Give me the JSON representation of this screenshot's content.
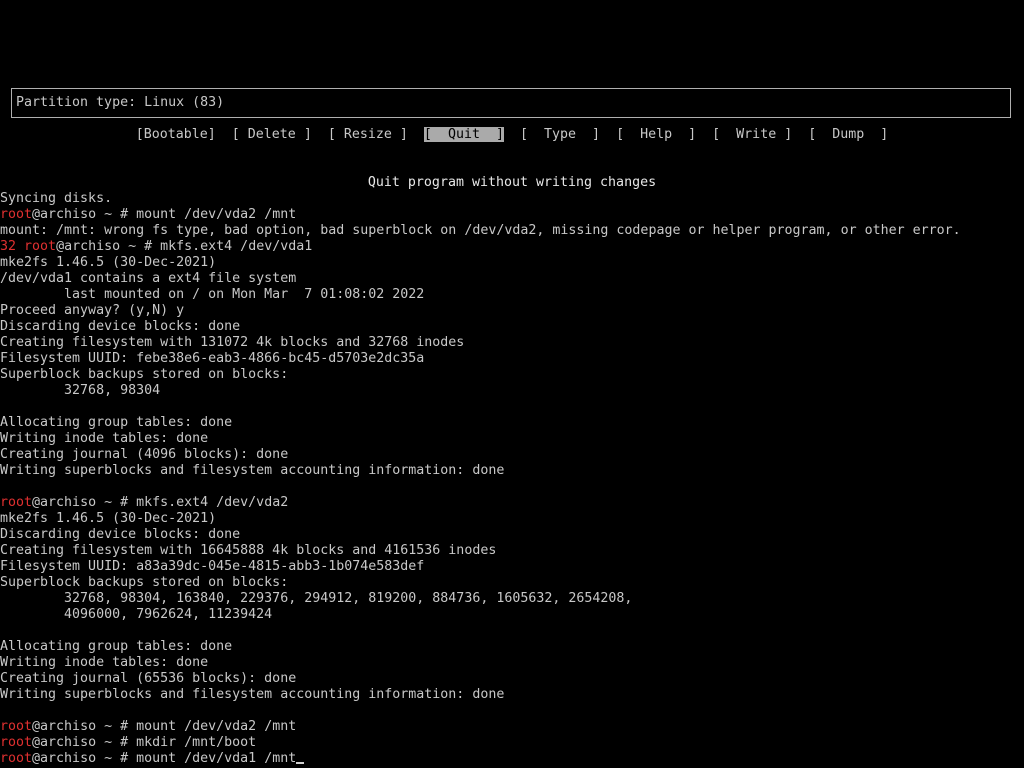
{
  "partition": {
    "type_text": "Partition type: Linux (83)"
  },
  "menu": [
    {
      "label": "[Bootable]",
      "selected": false
    },
    {
      "label": "[ Delete ]",
      "selected": false
    },
    {
      "label": "[ Resize ]",
      "selected": false
    },
    {
      "label": "[  Quit  ]",
      "selected": true
    },
    {
      "label": "[  Type  ]",
      "selected": false
    },
    {
      "label": "[  Help  ]",
      "selected": false
    },
    {
      "label": "[  Write ]",
      "selected": false
    },
    {
      "label": "[  Dump  ]",
      "selected": false
    }
  ],
  "hint": "Quit program without writing changes",
  "terminal": {
    "lines": [
      {
        "text": "Syncing disks."
      },
      {
        "prompt": "root",
        "rest": "@archiso ~ # mount /dev/vda2 /mnt"
      },
      {
        "text": "mount: /mnt: wrong fs type, bad option, bad superblock on /dev/vda2, missing codepage or helper program, or other error."
      },
      {
        "prefix": "32 ",
        "prompt": "root",
        "rest": "@archiso ~ # mkfs.ext4 /dev/vda1"
      },
      {
        "text": "mke2fs 1.46.5 (30-Dec-2021)"
      },
      {
        "text": "/dev/vda1 contains a ext4 file system"
      },
      {
        "text": "        last mounted on / on Mon Mar  7 01:08:02 2022"
      },
      {
        "text": "Proceed anyway? (y,N) y"
      },
      {
        "text": "Discarding device blocks: done"
      },
      {
        "text": "Creating filesystem with 131072 4k blocks and 32768 inodes"
      },
      {
        "text": "Filesystem UUID: febe38e6-eab3-4866-bc45-d5703e2dc35a"
      },
      {
        "text": "Superblock backups stored on blocks:"
      },
      {
        "text": "        32768, 98304"
      },
      {
        "text": ""
      },
      {
        "text": "Allocating group tables: done"
      },
      {
        "text": "Writing inode tables: done"
      },
      {
        "text": "Creating journal (4096 blocks): done"
      },
      {
        "text": "Writing superblocks and filesystem accounting information: done"
      },
      {
        "text": ""
      },
      {
        "prompt": "root",
        "rest": "@archiso ~ # mkfs.ext4 /dev/vda2"
      },
      {
        "text": "mke2fs 1.46.5 (30-Dec-2021)"
      },
      {
        "text": "Discarding device blocks: done"
      },
      {
        "text": "Creating filesystem with 16645888 4k blocks and 4161536 inodes"
      },
      {
        "text": "Filesystem UUID: a83a39dc-045e-4815-abb3-1b074e583def"
      },
      {
        "text": "Superblock backups stored on blocks:"
      },
      {
        "text": "        32768, 98304, 163840, 229376, 294912, 819200, 884736, 1605632, 2654208,"
      },
      {
        "text": "        4096000, 7962624, 11239424"
      },
      {
        "text": ""
      },
      {
        "text": "Allocating group tables: done"
      },
      {
        "text": "Writing inode tables: done"
      },
      {
        "text": "Creating journal (65536 blocks): done"
      },
      {
        "text": "Writing superblocks and filesystem accounting information: done"
      },
      {
        "text": ""
      },
      {
        "prompt": "root",
        "rest": "@archiso ~ # mount /dev/vda2 /mnt"
      },
      {
        "prompt": "root",
        "rest": "@archiso ~ # mkdir /mnt/boot"
      },
      {
        "prompt": "root",
        "rest": "@archiso ~ # mount /dev/vda1 /mnt",
        "cursor": true
      }
    ]
  }
}
